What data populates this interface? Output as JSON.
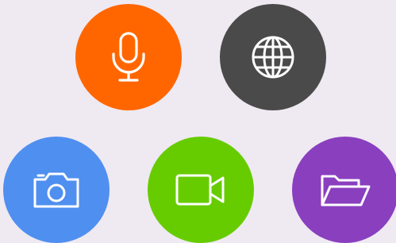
{
  "background_color": "#efe9f2",
  "buttons": [
    {
      "id": "microphone",
      "icon": "microphone-icon",
      "color": "#ff6600"
    },
    {
      "id": "globe",
      "icon": "globe-icon",
      "color": "#4a4a4a"
    },
    {
      "id": "camera",
      "icon": "camera-icon",
      "color": "#4f8ff0"
    },
    {
      "id": "video",
      "icon": "video-camera-icon",
      "color": "#66cc00"
    },
    {
      "id": "folder",
      "icon": "folder-open-icon",
      "color": "#8a3fbf"
    }
  ]
}
